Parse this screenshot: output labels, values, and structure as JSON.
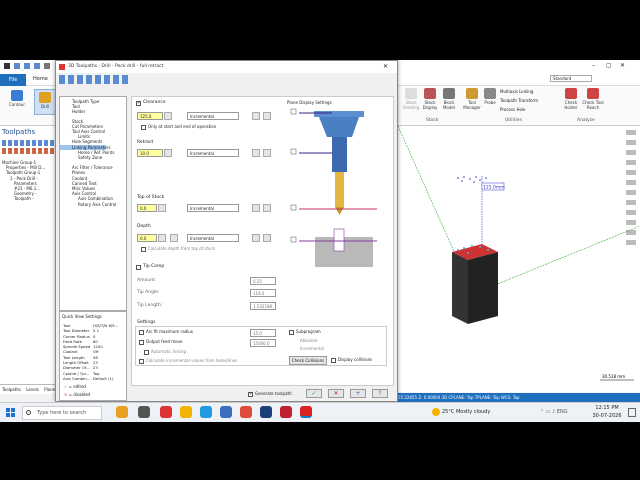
{
  "dialog": {
    "title": "3D Toolpaths - Drill - Peck drill - full retract",
    "tree": [
      "Toolpath Type",
      "Tool",
      "Holder",
      "Stock",
      "Cut Parameters",
      "Tool Axis Control",
      "Limits",
      "Hole Segments",
      "Linking Parameters",
      "Home / Ref. Points",
      "Safety Zone",
      "Arc Filter / Tolerance",
      "Planes",
      "Coolant",
      "Canned Text",
      "Misc Values",
      "Axis Control",
      "Axis Combination",
      "Rotary Axis Control"
    ],
    "clearance": {
      "label": "Clearance",
      "value": "125.0",
      "mode": "Incremental",
      "only_start_end": "Only at start and end of operation"
    },
    "retract": {
      "label": "Retract",
      "value": "10.0",
      "mode": "Incremental"
    },
    "top_of_stock": {
      "label": "Top of Stock",
      "value": "0.0",
      "mode": "Incremental"
    },
    "depth": {
      "label": "Depth",
      "value": "0.0",
      "mode": "Incremental",
      "calc": "Calculate depth from top of stock"
    },
    "tip_comp": {
      "label": "Tip Comp",
      "amount_label": "Amount:",
      "amount": "0.25",
      "angle_label": "Tip Angle:",
      "angle": "118.0",
      "length_label": "Tip Length:",
      "length": "1.532188"
    },
    "settings": {
      "label": "Settings",
      "arc_fit": "Arc fit maximum radius",
      "arc_fit_val": "15.0",
      "output_feed": "Output feed move",
      "output_feed_val": "15000.0",
      "auto_linking": "Automatic linking",
      "calc_incr": "Calculate incremental values from holes/lines",
      "subprogram": "Subprogram",
      "absolute": "Absolute",
      "incremental": "Incremental",
      "check_collisions": "Check Collisions",
      "display_collisions": "Display collisions"
    },
    "plane_display": "Plane Display Settings",
    "generate": "Generate toolpath",
    "quick_view": {
      "title": "Quick View Settings",
      "rows": [
        [
          "Tool",
          "H/S/T/N 8/9..."
        ],
        [
          "Tool Diameter",
          "5.1"
        ],
        [
          "Corner Radius",
          "0"
        ],
        [
          "Feed Rate",
          "80"
        ],
        [
          "Spindle Speed",
          "1200"
        ],
        [
          "Coolant",
          "Off"
        ],
        [
          "Tool Length",
          "56"
        ],
        [
          "Length Offset",
          "23"
        ],
        [
          "Diameter Of...",
          "23"
        ],
        [
          "Cplane / Tpl...",
          "Top"
        ],
        [
          "Axis Combin...",
          "Default (1)"
        ]
      ],
      "edited": "= edited",
      "disabled": "= disabled"
    }
  },
  "app": {
    "file_tab": "File",
    "home_tab": "Home",
    "contour": "Contour",
    "drill": "Drill",
    "toolpaths_title": "Toolpaths",
    "tree": [
      "Machine Group-1",
      "Properties - Mill D...",
      "Toolpath Group-1",
      "1 - Peck Drill -",
      "Parameters",
      "#21 - M6.1...",
      "Geometry -",
      "Toolpath -"
    ],
    "bottom_tabs": [
      "Toolpaths",
      "Levels",
      "Planes"
    ],
    "ribbon_right": [
      "Stock Shading",
      "Stock Display",
      "Block Model",
      "Tool Manager",
      "Probe",
      "Multiaxis Linking",
      "Toolpath Transform",
      "Process Hole",
      "Check Holder",
      "Check Tool Reach"
    ],
    "groups": [
      "Stock",
      "Utilities",
      "Analyze"
    ],
    "standard": "Standard",
    "dim_label": "125.0mm",
    "scale_label": "30.518 mm",
    "status": "55.22655   Z: 0.00000   3D   CPLANE: Top   TPLANE: Top   WCS: Top"
  },
  "taskbar": {
    "search": "Type here to search",
    "weather": "25°C  Mostly cloudy",
    "time": "12:15 PM",
    "date": "30-07-2026"
  }
}
